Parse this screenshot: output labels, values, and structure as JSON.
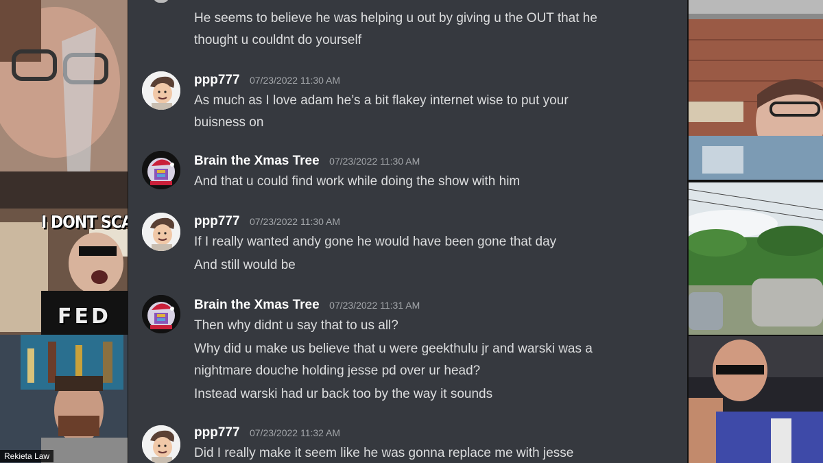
{
  "side_tiles": {
    "left_meme_text": "I DONT SCAI",
    "left_shirt_text": "FED",
    "left_name_tag": "Rekieta Law"
  },
  "chat": {
    "top_lines": [
      "He seems to believe he was helping u out by giving u the OUT that he",
      "thought u couldnt do yourself"
    ],
    "messages": [
      {
        "username": "ppp777",
        "timestamp": "07/23/2022 11:30 AM",
        "avatar": "cartoon-face-avatar",
        "lines": [
          "As much as I love adam he’s a bit flakey internet wise to put your",
          "buisness on"
        ]
      },
      {
        "username": "Brain the Xmas Tree",
        "timestamp": "07/23/2022 11:30 AM",
        "avatar": "santa-logo-avatar",
        "lines": [
          "And that u could find work while doing the show with him"
        ]
      },
      {
        "username": "ppp777",
        "timestamp": "07/23/2022 11:30 AM",
        "avatar": "cartoon-face-avatar",
        "lines": [
          "If I really wanted andy gone he would have been gone that day",
          "And still would be"
        ]
      },
      {
        "username": "Brain the Xmas Tree",
        "timestamp": "07/23/2022 11:31 AM",
        "avatar": "santa-logo-avatar",
        "lines": [
          "Then why didnt u say that to us all?",
          "Why did u make us believe that u were geekthulu jr and warski was a",
          "nightmare douche holding jesse pd over ur head?",
          "Instead warski had ur back too by the way it sounds"
        ]
      },
      {
        "username": "ppp777",
        "timestamp": "07/23/2022 11:32 AM",
        "avatar": "cartoon-face-avatar",
        "lines": [
          "Did I really make it seem like he was gonna replace me with jesse"
        ]
      }
    ]
  },
  "colors": {
    "chat_background": "#36393f",
    "username": "#ffffff",
    "message_text": "#dcddde",
    "timestamp": "#a3a6aa"
  }
}
